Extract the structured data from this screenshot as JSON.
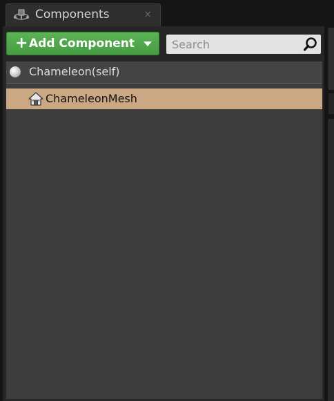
{
  "tab": {
    "title": "Components",
    "close_glyph": "×",
    "icon": "components-icon"
  },
  "toolbar": {
    "add_button": {
      "plus": "+",
      "label": "Add Component",
      "caret_icon": "chevron-down-icon"
    },
    "search": {
      "placeholder": "Search",
      "value": "",
      "icon": "search-icon"
    }
  },
  "tree": {
    "root": {
      "label": "Chameleon(self)",
      "icon": "sphere-icon"
    },
    "items": [
      {
        "label": "ChameleonMesh",
        "icon": "house-icon",
        "selected": true
      }
    ]
  },
  "colors": {
    "accent_green": "#4fa24a",
    "selection": "#c9a883",
    "panel_bg": "#3c3c3c"
  }
}
